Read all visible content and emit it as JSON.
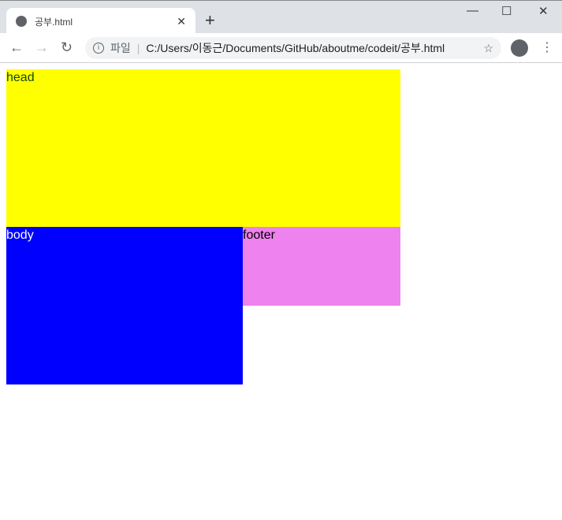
{
  "tab": {
    "title": "공부.html",
    "close": "✕",
    "new_tab": "+"
  },
  "window": {
    "minimize": "—",
    "maximize": "☐",
    "close": "✕"
  },
  "toolbar": {
    "back": "←",
    "forward": "→",
    "reload": "↻",
    "info": "i",
    "scheme_label": "파일",
    "separator": "|",
    "url": "C:/Users/이동근/Documents/GitHub/aboutme/codeit/공부.html",
    "star": "☆",
    "menu": "⋮"
  },
  "page": {
    "head": "head",
    "body": "body",
    "footer": "footer"
  },
  "colors": {
    "head": "#ffff00",
    "body": "#0000ff",
    "footer": "#ee82ee"
  }
}
